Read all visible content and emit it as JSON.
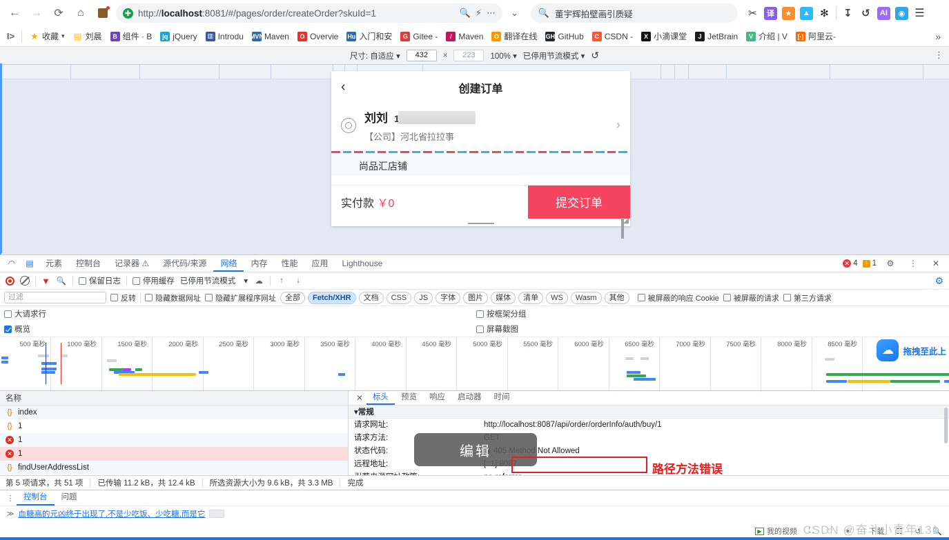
{
  "browser": {
    "nav": {
      "back": "←",
      "forward": "→",
      "reload": "⟳",
      "home": "⌂"
    },
    "omnibox": {
      "scheme": "http://",
      "host": "localhost",
      "rest": ":8081/#/pages/order/createOrder?skuId=1",
      "full_url": "http://localhost:8081/#/pages/order/createOrder?skuId=1",
      "zoom_icon": "search-minus",
      "bolt_icon": "⚡",
      "more_icon": "⋯",
      "chevron_icon": "⌄"
    },
    "search": {
      "placeholder": "董宇辉拍壁画引质疑",
      "value": "董宇辉拍壁画引质疑"
    },
    "extensions": [
      "scissors-icon",
      "translate-icon",
      "game-icon",
      "ai-icon",
      "puzzle-icon",
      "download-icon",
      "history-icon",
      "adblock-icon",
      "sync-icon",
      "menu-icon"
    ],
    "bookmarks": [
      {
        "label": "收藏",
        "icon": "star",
        "color": "#f5b400"
      },
      {
        "label": "刘晨",
        "icon": "folder",
        "color": "#f0c040"
      },
      {
        "label": "组件 · B",
        "icon": "B",
        "color": "#6f42c1"
      },
      {
        "label": "jQuery",
        "icon": "jq",
        "color": "#1aa7d8"
      },
      {
        "label": "Introdu",
        "icon": "book",
        "color": "#3b5998"
      },
      {
        "label": "Maven",
        "icon": "MVN",
        "color": "#2b6cb0"
      },
      {
        "label": "Overvie",
        "icon": "O",
        "color": "#e8332a"
      },
      {
        "label": "入门和安",
        "icon": "Hu",
        "color": "#2b6cb0"
      },
      {
        "label": "Gitee -",
        "icon": "G",
        "color": "#e03a3a"
      },
      {
        "label": "Maven",
        "icon": "/",
        "color": "#c2185b"
      },
      {
        "label": "翻译在线",
        "icon": "O",
        "color": "#ff9800"
      },
      {
        "label": "GitHub",
        "icon": "GH",
        "color": "#24292e"
      },
      {
        "label": "CSDN -",
        "icon": "C",
        "color": "#fc5531"
      },
      {
        "label": "小滴课堂",
        "icon": "X",
        "color": "#111111"
      },
      {
        "label": "JetBrain",
        "icon": "J",
        "color": "#1b1b1b"
      },
      {
        "label": "介绍 | V",
        "icon": "V",
        "color": "#42b883"
      },
      {
        "label": "阿里云-",
        "icon": "[-]",
        "color": "#ff6a00"
      }
    ],
    "bookmarks_overflow": "»"
  },
  "device_bar": {
    "size_label": "尺寸: 自适应",
    "width": "432",
    "height": "223",
    "x_sep": "×",
    "zoom": "100%",
    "throttle": "已停用节流模式",
    "rotate_icon": "rotate-icon",
    "kebab": "⋮"
  },
  "phone": {
    "back_icon": "‹",
    "title": "创建订单",
    "address": {
      "name": "刘刘",
      "phone": "13",
      "detail": "【公司】河北省拉拉事",
      "chevron": "›"
    },
    "shop": "尚品汇店铺",
    "pay_label": "实付款",
    "pay_currency": "￥",
    "pay_amount": "0",
    "submit": "提交订单"
  },
  "devtools": {
    "icons": [
      "inspect-icon",
      "device-toggle-icon"
    ],
    "tabs": [
      {
        "label": "元素",
        "active": false
      },
      {
        "label": "控制台",
        "active": false
      },
      {
        "label": "记录器",
        "active": false,
        "suffix": "⚠"
      },
      {
        "label": "源代码/来源",
        "active": false
      },
      {
        "label": "网络",
        "active": true
      },
      {
        "label": "内存",
        "active": false
      },
      {
        "label": "性能",
        "active": false
      },
      {
        "label": "应用",
        "active": false
      },
      {
        "label": "Lighthouse",
        "active": false
      }
    ],
    "error_count": "4",
    "warning_count": "1",
    "settings_icon": "gear-icon",
    "kebab_icon": "⋮",
    "close_icon": "✕"
  },
  "network_toolbar": {
    "record_icon": "record-icon",
    "clear_icon": "clear-icon",
    "filter_icon": "filter-icon",
    "search_icon": "search-icon",
    "preserve_log": "保留日志",
    "disable_cache": "停用缓存",
    "throttling": "已停用节流模式",
    "throttle_caret": "▾",
    "wifi_icon": "wifi-icon",
    "import_icon": "import-icon",
    "export_icon": "export-icon",
    "gear_icon": "gear-icon"
  },
  "network_filters": {
    "filter_placeholder": "过滤",
    "invert": "反转",
    "hide_data_urls": "隐藏数据网址",
    "hide_ext_urls": "隐藏扩展程序网址",
    "types": [
      {
        "label": "全部",
        "active": false
      },
      {
        "label": "Fetch/XHR",
        "active": true
      },
      {
        "label": "文档",
        "active": false
      },
      {
        "label": "CSS",
        "active": false
      },
      {
        "label": "JS",
        "active": false
      },
      {
        "label": "字体",
        "active": false
      },
      {
        "label": "图片",
        "active": false
      },
      {
        "label": "媒体",
        "active": false
      },
      {
        "label": "清单",
        "active": false
      },
      {
        "label": "WS",
        "active": false
      },
      {
        "label": "Wasm",
        "active": false
      },
      {
        "label": "其他",
        "active": false
      }
    ],
    "blocked_cookies": "被屏蔽的响应 Cookie",
    "blocked_requests": "被屏蔽的请求",
    "third_party": "第三方请求"
  },
  "network_options": {
    "big_request_rows": "大请求行",
    "overview": "概览",
    "group_by_frame": "按框架分组",
    "screenshots": "屏幕截图"
  },
  "overview": {
    "unit": "毫秒",
    "ticks": [
      "500",
      "1000",
      "1500",
      "2000",
      "2500",
      "3000",
      "3500",
      "4000",
      "4500",
      "5000",
      "5500",
      "6000",
      "6500",
      "7000",
      "7500",
      "8000",
      "8500"
    ],
    "upload_label": "拖拽至此上",
    "upload_icon": "upload-cloud-icon"
  },
  "request_list": {
    "header": "名称",
    "rows": [
      {
        "name": "index",
        "status": "ok",
        "selected": false
      },
      {
        "name": "1",
        "status": "ok",
        "selected": false
      },
      {
        "name": "1",
        "status": "error",
        "selected": false
      },
      {
        "name": "1",
        "status": "error",
        "selected": true
      },
      {
        "name": "findUserAddressList",
        "status": "ok",
        "selected": false
      }
    ]
  },
  "detail_panel": {
    "close": "✕",
    "tabs": [
      {
        "label": "标头",
        "active": true
      },
      {
        "label": "预览",
        "active": false
      },
      {
        "label": "响应",
        "active": false
      },
      {
        "label": "启动器",
        "active": false
      },
      {
        "label": "时间",
        "active": false
      }
    ],
    "section_title": "常规",
    "section_caret": "▾",
    "rows": [
      {
        "key": "请求网址:",
        "value": "http://localhost:8087/api/order/orderInfo/auth/buy/1"
      },
      {
        "key": "请求方法:",
        "value": "GET"
      },
      {
        "key": "状态代码:",
        "value": "405 Method Not Allowed",
        "status_dot": true
      },
      {
        "key": "远程地址:",
        "value": "[::1]:8087"
      },
      {
        "key": "引荐来源网址政策:",
        "value": "no-referrer"
      }
    ]
  },
  "annotations": {
    "edit_overlay": "编辑",
    "error_note": "路径方法错误",
    "error_note_color": "#ef1b1b"
  },
  "status_bar": {
    "requests": "第 5 项请求，共 51 项",
    "transferred": "已传输 11.2 kB，共 12.4 kB",
    "resources": "所选资源大小为 9.6 kB，共 3.3 MB",
    "finish": "完成"
  },
  "drawer": {
    "kebab": "⋮",
    "tabs": [
      {
        "label": "控制台",
        "active": true
      },
      {
        "label": "问题",
        "active": false
      }
    ],
    "message": "血糖高的元凶终于出现了,不是少吃饭、少吃糖,而是它",
    "chevron": "≫"
  },
  "footer": {
    "items": [
      {
        "label": "我的视频",
        "icon": "play-icon"
      },
      {
        "label": "",
        "icon": "image-icon"
      },
      {
        "label": "",
        "icon": "heart-icon"
      },
      {
        "label": "",
        "icon": "rocket-icon"
      },
      {
        "label": "下载",
        "icon": "download-icon"
      },
      {
        "label": "",
        "icon": "grid-icon"
      },
      {
        "label": "",
        "icon": "refresh-icon"
      },
      {
        "label": "",
        "icon": "search-icon"
      }
    ]
  },
  "watermark": "CSDN @奋斗小青年131"
}
